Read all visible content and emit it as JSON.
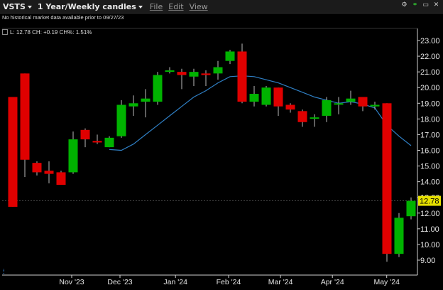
{
  "window": {
    "symbol": "VSTS",
    "timeframe": "1 Year/Weekly candles",
    "menus": [
      "File",
      "Edit",
      "View"
    ]
  },
  "readout": {
    "notice": "No historical market data available prior to 09/27/23",
    "values": "L: 12.78 CH: +0.19 CH%: 1.51%"
  },
  "icons": [
    "gear-icon",
    "link-icon",
    "maximize-icon",
    "close-icon"
  ],
  "colors": {
    "up": "#00b300",
    "down": "#e00000",
    "ma": "#2f7fc4",
    "last_price": "#e6e000"
  },
  "chart_data": {
    "type": "candlestick",
    "ylim": [
      8.6,
      23.4
    ],
    "yticks": [
      "9.00",
      "10.00",
      "11.00",
      "12.00",
      "13.00",
      "14.00",
      "15.00",
      "16.00",
      "17.00",
      "18.00",
      "19.00",
      "20.00",
      "21.00",
      "22.00",
      "23.00"
    ],
    "xticks": [
      "Nov '23",
      "Dec '23",
      "Jan '24",
      "Feb '24",
      "Mar '24",
      "Apr '24",
      "May '24"
    ],
    "last_price": "12.78",
    "candles": [
      {
        "o": 12.4,
        "h": 12.5,
        "l": 19.1,
        "c": 19.4,
        "dir": "up-flat"
      },
      {
        "o": 20.9,
        "h": 20.9,
        "l": 14.3,
        "c": 15.4,
        "dir": "down"
      },
      {
        "o": 15.2,
        "h": 15.3,
        "l": 14.4,
        "c": 14.6,
        "dir": "down"
      },
      {
        "o": 14.7,
        "h": 15.3,
        "l": 13.9,
        "c": 14.5,
        "dir": "down"
      },
      {
        "o": 14.6,
        "h": 14.7,
        "l": 13.8,
        "c": 13.8,
        "dir": "down"
      },
      {
        "o": 14.6,
        "h": 17.2,
        "l": 14.5,
        "c": 16.7,
        "dir": "up"
      },
      {
        "o": 17.3,
        "h": 17.4,
        "l": 16.2,
        "c": 16.7,
        "dir": "down"
      },
      {
        "o": 16.6,
        "h": 17.0,
        "l": 16.4,
        "c": 16.5,
        "dir": "down"
      },
      {
        "o": 16.2,
        "h": 16.9,
        "l": 16.2,
        "c": 16.8,
        "dir": "up"
      },
      {
        "o": 16.9,
        "h": 19.2,
        "l": 16.8,
        "c": 18.9,
        "dir": "up"
      },
      {
        "o": 18.8,
        "h": 19.5,
        "l": 18.2,
        "c": 19.0,
        "dir": "up"
      },
      {
        "o": 19.1,
        "h": 19.9,
        "l": 18.1,
        "c": 19.3,
        "dir": "up"
      },
      {
        "o": 19.1,
        "h": 21.0,
        "l": 18.9,
        "c": 20.8,
        "dir": "up"
      },
      {
        "o": 21.0,
        "h": 21.3,
        "l": 20.9,
        "c": 21.1,
        "dir": "up"
      },
      {
        "o": 21.0,
        "h": 21.2,
        "l": 19.9,
        "c": 20.8,
        "dir": "down"
      },
      {
        "o": 20.7,
        "h": 21.2,
        "l": 20.1,
        "c": 21.0,
        "dir": "up"
      },
      {
        "o": 20.9,
        "h": 21.1,
        "l": 20.1,
        "c": 20.8,
        "dir": "down"
      },
      {
        "o": 20.9,
        "h": 21.7,
        "l": 20.5,
        "c": 21.3,
        "dir": "up"
      },
      {
        "o": 21.7,
        "h": 22.4,
        "l": 21.5,
        "c": 22.3,
        "dir": "up"
      },
      {
        "o": 22.3,
        "h": 22.8,
        "l": 19.0,
        "c": 19.1,
        "dir": "down"
      },
      {
        "o": 19.1,
        "h": 20.1,
        "l": 18.8,
        "c": 19.6,
        "dir": "up"
      },
      {
        "o": 18.9,
        "h": 20.1,
        "l": 18.8,
        "c": 20.0,
        "dir": "up"
      },
      {
        "o": 20.0,
        "h": 20.0,
        "l": 18.2,
        "c": 18.8,
        "dir": "down"
      },
      {
        "o": 18.9,
        "h": 19.0,
        "l": 18.4,
        "c": 18.6,
        "dir": "down"
      },
      {
        "o": 18.5,
        "h": 18.6,
        "l": 17.5,
        "c": 17.8,
        "dir": "down"
      },
      {
        "o": 18.1,
        "h": 18.3,
        "l": 17.5,
        "c": 18.1,
        "dir": "up"
      },
      {
        "o": 18.2,
        "h": 19.4,
        "l": 17.8,
        "c": 19.2,
        "dir": "up"
      },
      {
        "o": 19.0,
        "h": 19.4,
        "l": 18.3,
        "c": 19.0,
        "dir": "up"
      },
      {
        "o": 19.1,
        "h": 19.8,
        "l": 18.9,
        "c": 19.3,
        "dir": "up"
      },
      {
        "o": 19.4,
        "h": 19.4,
        "l": 18.5,
        "c": 18.8,
        "dir": "down"
      },
      {
        "o": 18.8,
        "h": 19.1,
        "l": 18.6,
        "c": 18.9,
        "dir": "up"
      },
      {
        "o": 19.0,
        "h": 19.0,
        "l": 8.9,
        "c": 9.4,
        "dir": "down"
      },
      {
        "o": 9.4,
        "h": 12.0,
        "l": 9.2,
        "c": 11.7,
        "dir": "up"
      },
      {
        "o": 11.8,
        "h": 13.0,
        "l": 11.6,
        "c": 12.78,
        "dir": "up"
      }
    ],
    "ma": [
      null,
      null,
      null,
      null,
      null,
      null,
      null,
      null,
      16.05,
      16.0,
      16.4,
      17.0,
      17.6,
      18.2,
      18.8,
      19.4,
      19.8,
      20.3,
      20.7,
      20.75,
      20.7,
      20.5,
      20.3,
      20.0,
      19.7,
      19.4,
      19.2,
      19.0,
      19.1,
      18.95,
      18.7,
      17.6,
      16.9,
      16.3
    ],
    "grid": false
  }
}
